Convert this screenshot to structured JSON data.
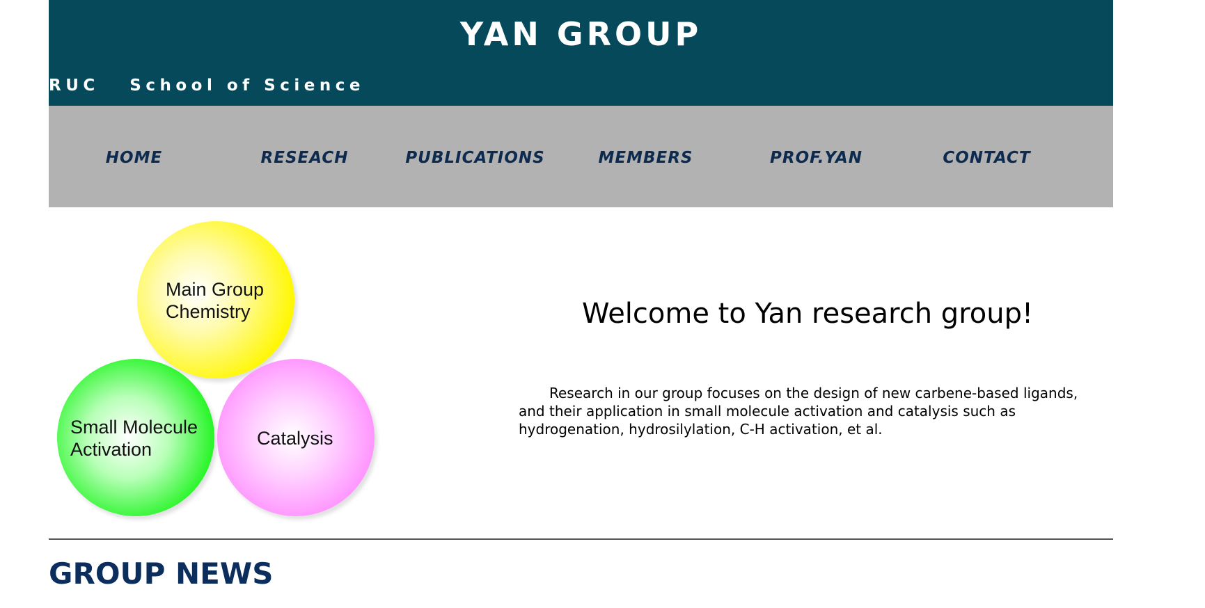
{
  "header": {
    "title": "YAN GROUP",
    "subtitle": "RUC   School of Science",
    "background_color": "#05495a"
  },
  "nav": {
    "background_color": "#b2b2b2",
    "items": [
      {
        "label": "HOME"
      },
      {
        "label": "RESEACH"
      },
      {
        "label": "PUBLICATIONS"
      },
      {
        "label": "MEMBERS"
      },
      {
        "label": "PROF.YAN"
      },
      {
        "label": "CONTACT"
      }
    ]
  },
  "research_areas": {
    "main_group": {
      "label": "Main Group\nChemistry",
      "color": "#fff700"
    },
    "small_molecule": {
      "label": "Small Molecule\nActivation",
      "color": "#22f522"
    },
    "catalysis": {
      "label": "Catalysis",
      "color": "#ff88ff"
    }
  },
  "welcome": {
    "title": "Welcome to Yan research group!",
    "text": "Research in our group focuses on the design of new carbene-based ligands, and their application in small molecule activation and catalysis such as hydrogenation, hydrosilylation, C-H activation, et al."
  },
  "news": {
    "heading": "GROUP NEWS",
    "heading_color": "#0b2e5c"
  }
}
